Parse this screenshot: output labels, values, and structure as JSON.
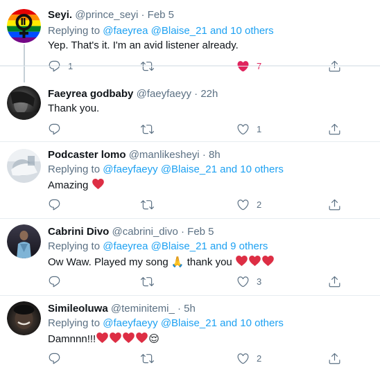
{
  "tweets": [
    {
      "name": "Seyi.",
      "handle": "@prince_seyi",
      "separator": "·",
      "time": "Feb 5",
      "replying_prefix": "Replying to",
      "replying_users": "@faeyrea @Blaise_21",
      "replying_others": "and 10 others",
      "text": "Yep. That's it. I'm an avid listener already.",
      "replies": "1",
      "likes": "7",
      "liked": true
    },
    {
      "name": "Faeyrea godbaby",
      "handle": "@faeyfaeyy",
      "separator": "·",
      "time": "22h",
      "text": "Thank you.",
      "likes": "1"
    },
    {
      "name": "Podcaster lomo",
      "handle": "@manlikesheyi",
      "separator": "·",
      "time": "8h",
      "replying_prefix": "Replying to",
      "replying_users": "@faeyfaeyy @Blaise_21",
      "replying_others": "and 10 others",
      "text": "Amazing",
      "likes": "2"
    },
    {
      "name": "Cabrini Divo",
      "handle": "@cabrini_divo",
      "separator": "·",
      "time": "Feb 5",
      "replying_prefix": "Replying to",
      "replying_users": "@faeyrea @Blaise_21",
      "replying_others": "and 9 others",
      "text_a": "Ow Waw. Played my song",
      "emoji_pray": "🙏",
      "text_b": "thank you",
      "likes": "3"
    },
    {
      "name": "Simileoluwa",
      "handle": "@teminitemi_",
      "separator": "·",
      "time": "5h",
      "replying_prefix": "Replying to",
      "replying_users": "@faeyfaeyy @Blaise_21",
      "replying_others": "and 10 others",
      "text": "Damnnn!!!",
      "emoji_relieved": "😌",
      "likes": "2"
    }
  ],
  "colors": {
    "link": "#1da1f2",
    "secondary": "#5b7083",
    "like": "#e0245e",
    "divider": "#e6ecf0"
  },
  "icons": {
    "reply": "reply-icon",
    "retweet": "retweet-icon",
    "like": "heart-icon",
    "share": "share-icon"
  }
}
